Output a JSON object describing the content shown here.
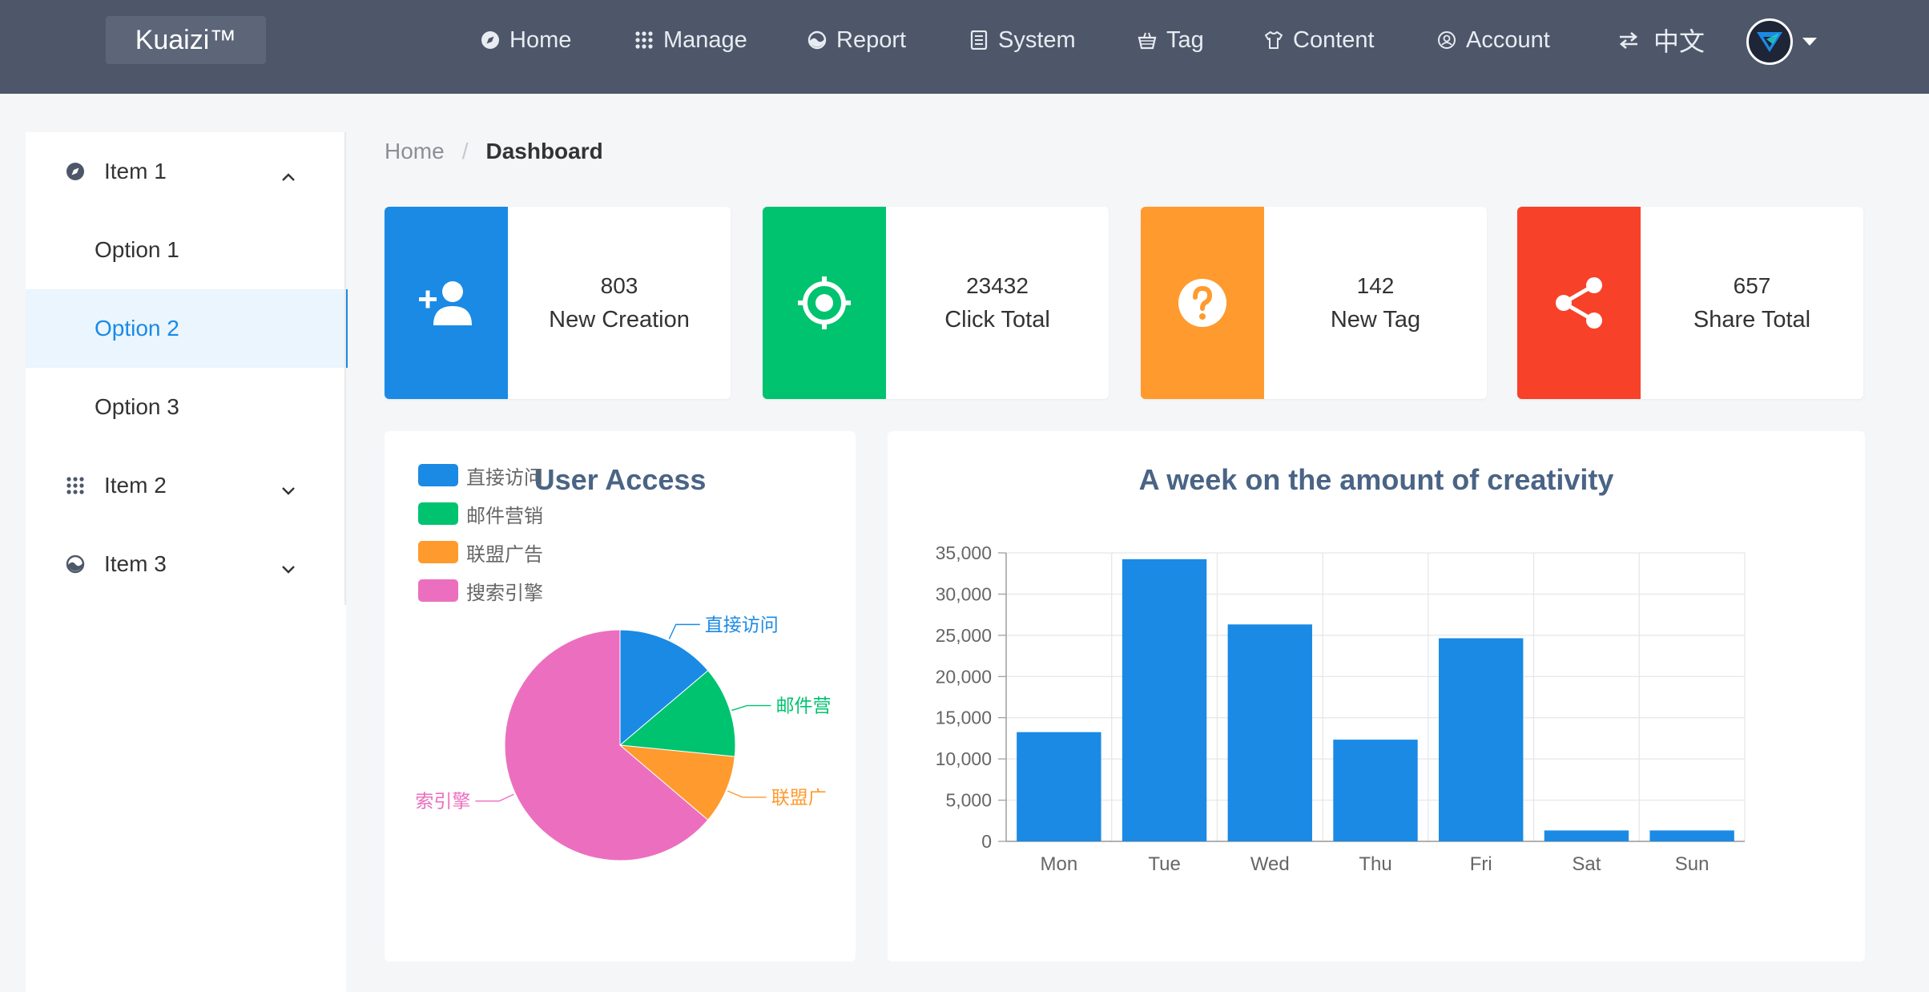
{
  "header": {
    "logo": "Kuaizi™",
    "nav": [
      {
        "label": "Home",
        "icon": "compass-icon"
      },
      {
        "label": "Manage",
        "icon": "grid-icon"
      },
      {
        "label": "Report",
        "icon": "chart-icon"
      },
      {
        "label": "System",
        "icon": "document-icon"
      },
      {
        "label": "Tag",
        "icon": "basket-icon"
      },
      {
        "label": "Content",
        "icon": "shirt-icon"
      },
      {
        "label": "Account",
        "icon": "account-icon"
      }
    ],
    "language": "中文"
  },
  "sidebar": {
    "groups": [
      {
        "label": "Item 1",
        "icon": "compass-icon",
        "expanded": true
      },
      {
        "label": "Item 2",
        "icon": "grid-icon",
        "expanded": false
      },
      {
        "label": "Item 3",
        "icon": "chart-icon",
        "expanded": false
      }
    ],
    "options": [
      "Option 1",
      "Option 2",
      "Option 3"
    ],
    "active_option": "Option 2"
  },
  "breadcrumb": {
    "home": "Home",
    "separator": "/",
    "current": "Dashboard"
  },
  "stats": [
    {
      "value": "803",
      "label": "New Creation",
      "color": "#1a8ae5",
      "icon": "add-user-icon"
    },
    {
      "value": "23432",
      "label": "Click Total",
      "color": "#00c36f",
      "icon": "target-icon"
    },
    {
      "value": "142",
      "label": "New Tag",
      "color": "#ff9a2e",
      "icon": "question-icon"
    },
    {
      "value": "657",
      "label": "Share Total",
      "color": "#f74128",
      "icon": "share-icon"
    }
  ],
  "chart_data": [
    {
      "type": "pie",
      "title": "User Access",
      "legend_position": "top-left",
      "slice_labels_visible": [
        "直接访问",
        "邮件营",
        "联盟广",
        "索引擎"
      ],
      "series": [
        {
          "name": "直接访问",
          "value": 335,
          "color": "#1a8ae5"
        },
        {
          "name": "邮件营销",
          "value": 310,
          "color": "#00c36f"
        },
        {
          "name": "联盟广告",
          "value": 234,
          "color": "#ff9a2e"
        },
        {
          "name": "搜索引擎",
          "value": 1548,
          "color": "#ec6fbf"
        }
      ]
    },
    {
      "type": "bar",
      "title": "A week on the amount of creativity",
      "categories": [
        "Mon",
        "Tue",
        "Wed",
        "Thu",
        "Fri",
        "Sat",
        "Sun"
      ],
      "values": [
        13253,
        34235,
        26321,
        12340,
        24643,
        1322,
        1324
      ],
      "ylim": [
        0,
        35000
      ],
      "yticks": [
        "0",
        "5,000",
        "10,000",
        "15,000",
        "20,000",
        "25,000",
        "30,000",
        "35,000"
      ],
      "grid": true,
      "color": "#1a8ae5"
    }
  ]
}
